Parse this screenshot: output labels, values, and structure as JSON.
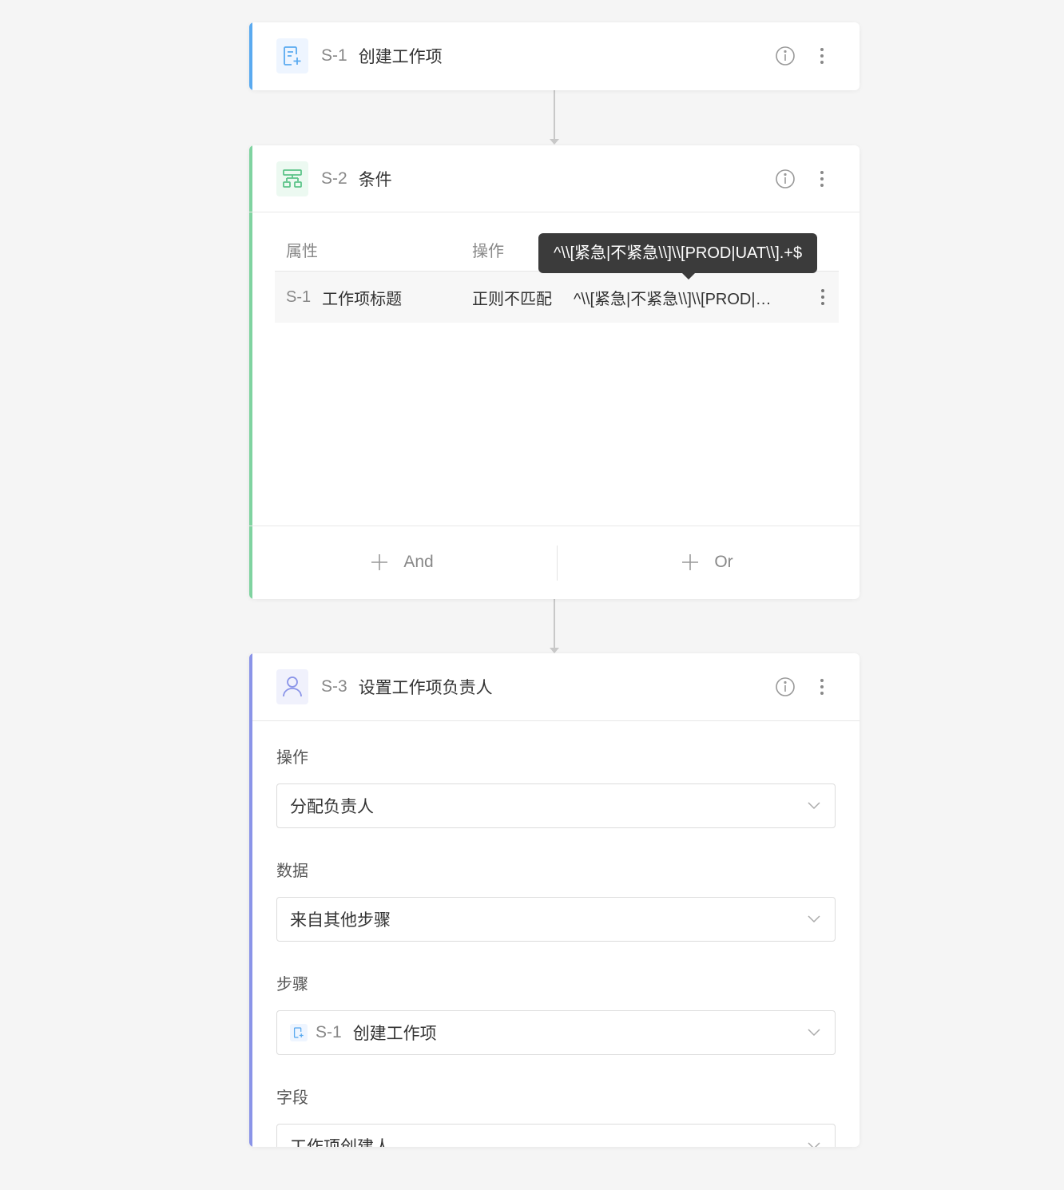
{
  "colors": {
    "accent_create": "#5aaaf0",
    "accent_condition": "#7fd3a0",
    "accent_assign": "#8a94e8"
  },
  "step1": {
    "id": "S-1",
    "title": "创建工作项",
    "icon": "create-item-icon"
  },
  "step2": {
    "id": "S-2",
    "title": "条件",
    "icon": "condition-branch-icon",
    "table": {
      "headers": {
        "attribute": "属性",
        "operation": "操作"
      },
      "rows": [
        {
          "step": "S-1",
          "field": "工作项标题",
          "operation": "正则不匹配",
          "value": "^\\\\[紧急|不紧急\\\\]\\\\[PROD|UAT\\\\].+$"
        }
      ]
    },
    "tooltip": "^\\\\[紧急|不紧急\\\\]\\\\[PROD|UAT\\\\].+$",
    "footer": {
      "and_label": "And",
      "or_label": "Or"
    }
  },
  "step3": {
    "id": "S-3",
    "title": "设置工作项负责人",
    "icon": "user-icon",
    "form": {
      "operation_label": "操作",
      "operation_value": "分配负责人",
      "data_label": "数据",
      "data_value": "来自其他步骤",
      "step_label": "步骤",
      "step_value_id": "S-1",
      "step_value_title": "创建工作项",
      "field_label": "字段",
      "field_value": "工作项创建人"
    }
  }
}
